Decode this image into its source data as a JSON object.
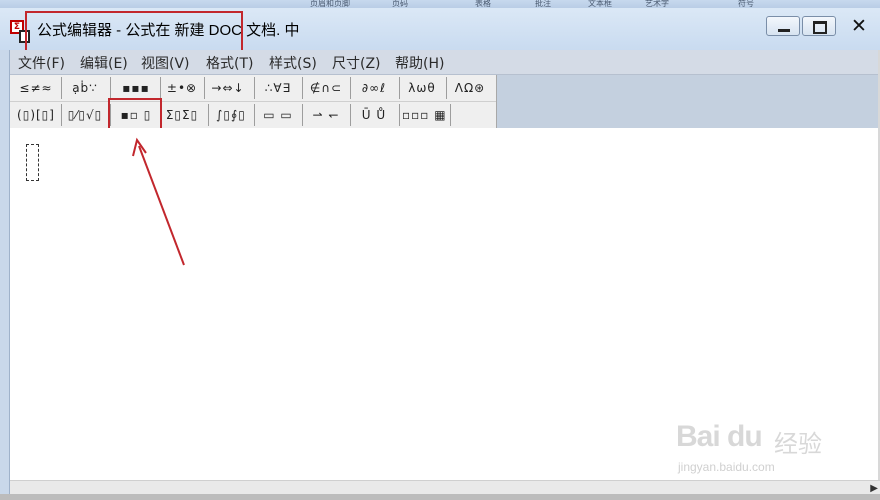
{
  "window": {
    "title": "公式编辑器 - 公式在 新建 DOC 文档. 中",
    "close_glyph": "✕"
  },
  "menubar": {
    "items": [
      {
        "label": "文件(F)"
      },
      {
        "label": "编辑(E)"
      },
      {
        "label": "视图(V)"
      },
      {
        "label": "格式(T)"
      },
      {
        "label": "样式(S)"
      },
      {
        "label": "尺寸(Z)"
      },
      {
        "label": "帮助(H)"
      }
    ]
  },
  "toolbar": {
    "symbol_row": [
      {
        "glyphs": "≤≠≈",
        "icon": "relations-palette-icon"
      },
      {
        "glyphs": "ạḃ∵",
        "icon": "spaces-ellipses-palette-icon"
      },
      {
        "glyphs": "▪▪▪",
        "icon": "embellishments-palette-icon"
      },
      {
        "glyphs": "±•⊗",
        "icon": "operators-palette-icon"
      },
      {
        "glyphs": "→⇔↓",
        "icon": "arrows-palette-icon"
      },
      {
        "glyphs": "∴∀∃",
        "icon": "logic-palette-icon"
      },
      {
        "glyphs": "∉∩⊂",
        "icon": "set-theory-palette-icon"
      },
      {
        "glyphs": "∂∞ℓ",
        "icon": "misc-symbols-palette-icon"
      },
      {
        "glyphs": "λωθ",
        "icon": "greek-lowercase-palette-icon"
      },
      {
        "glyphs": "ΛΩ⊛",
        "icon": "greek-uppercase-palette-icon"
      }
    ],
    "template_row": [
      {
        "glyphs": "(▯)[▯]",
        "icon": "fence-templates-icon"
      },
      {
        "glyphs": "▯⁄▯√▯",
        "icon": "fraction-radical-templates-icon"
      },
      {
        "glyphs": "▪▫ ▯",
        "icon": "subscript-superscript-templates-icon"
      },
      {
        "glyphs": "Σ▯Σ▯",
        "icon": "summation-templates-icon"
      },
      {
        "glyphs": "∫▯∮▯",
        "icon": "integral-templates-icon"
      },
      {
        "glyphs": "▭ ▭",
        "icon": "underbar-overbar-templates-icon"
      },
      {
        "glyphs": "⇀ ↽",
        "icon": "labeled-arrow-templates-icon"
      },
      {
        "glyphs": "Ū Ů",
        "icon": "products-set-theory-templates-icon"
      },
      {
        "glyphs": "▫▫▫ ▦",
        "icon": "matrix-templates-icon"
      }
    ]
  },
  "top_strip": {
    "items": [
      "页眉和页脚",
      "页码",
      "表格",
      "批注",
      "文本框",
      "艺术字",
      "符号"
    ]
  },
  "watermark": {
    "logo": "Bai du",
    "cn": "经验",
    "url": "jingyan.baidu.com"
  },
  "colors": {
    "annotation_red": "#c2272d",
    "title_bar": "#c9dbf0",
    "menu_bar": "#d4dbe6",
    "toolbar_bg": "#efefef"
  }
}
